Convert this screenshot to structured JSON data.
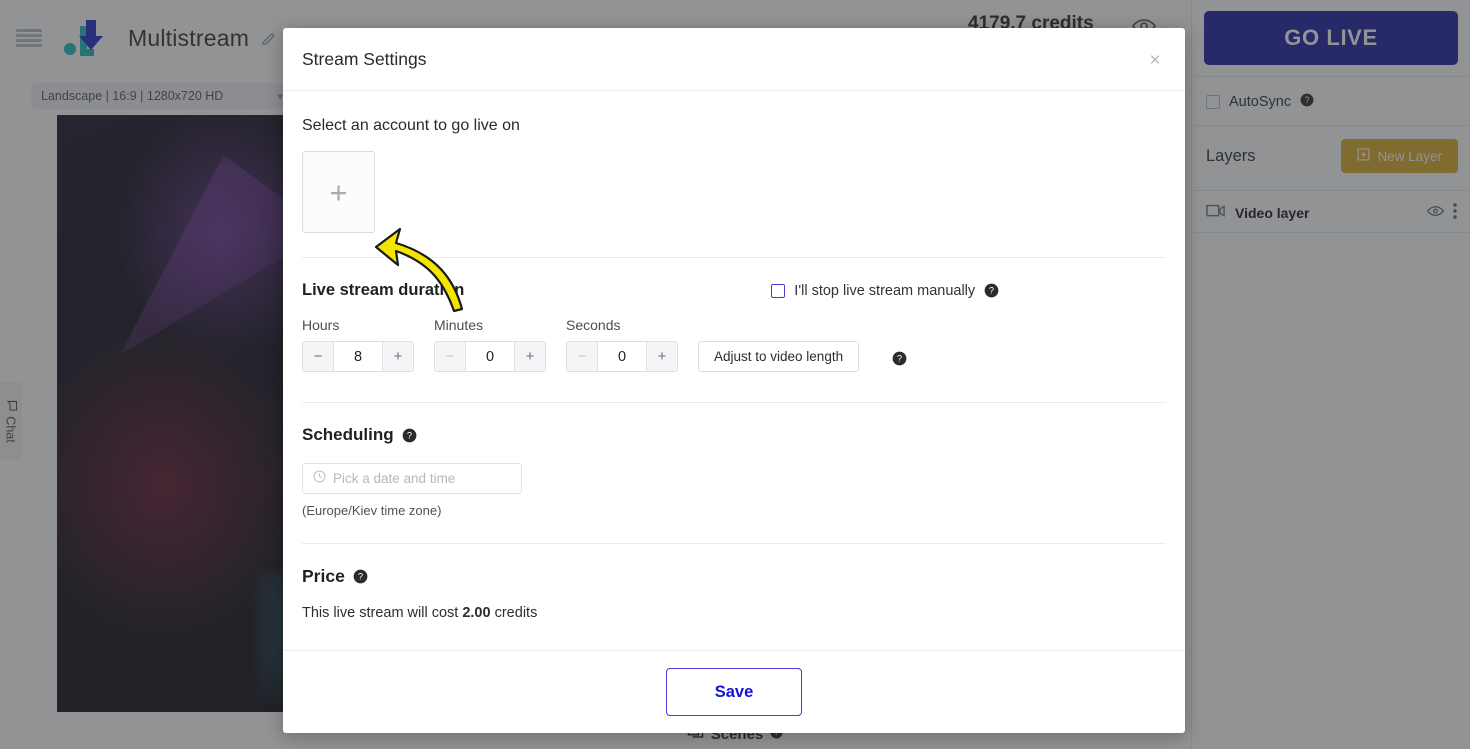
{
  "app": {
    "title": "Multistream",
    "credits": "4179.7 credits",
    "format_select": "Landscape | 16:9 | 1280x720 HD",
    "chat_tab": "Chat",
    "scenes_label": "Scenes"
  },
  "right_panel": {
    "go_live_label": "GO LIVE",
    "autosync_label": "AutoSync",
    "layers_title": "Layers",
    "new_layer_label": "New Layer",
    "layers": [
      {
        "name": "Video layer"
      }
    ]
  },
  "modal": {
    "title": "Stream Settings",
    "account_section": {
      "label": "Select an account to go live on",
      "add_button": "+"
    },
    "duration": {
      "heading": "Live stream duration",
      "manual_checkbox_label": "I'll stop live stream manually",
      "manual_checked": false,
      "fields": [
        {
          "caption": "Hours",
          "value": "8",
          "minus": "−",
          "plus": "+",
          "minus_disabled": false
        },
        {
          "caption": "Minutes",
          "value": "0",
          "minus": "−",
          "plus": "+",
          "minus_disabled": true
        },
        {
          "caption": "Seconds",
          "value": "0",
          "minus": "−",
          "plus": "+",
          "minus_disabled": true
        }
      ],
      "adjust_button": "Adjust to video length"
    },
    "scheduling": {
      "heading": "Scheduling",
      "date_placeholder": "Pick a date and time",
      "date_value": "",
      "timezone_note": "(Europe/Kiev time zone)"
    },
    "price": {
      "heading": "Price",
      "text_before": "This live stream will cost ",
      "amount": "2.00",
      "text_after": " credits"
    },
    "save_label": "Save",
    "close_icon": "×"
  },
  "colors": {
    "go_live_bg": "#14169c",
    "new_layer_bg": "#d9a61f",
    "save_border": "#4b3bd6",
    "save_text": "#1313d6",
    "arrow_annotation": "#f5e300"
  }
}
